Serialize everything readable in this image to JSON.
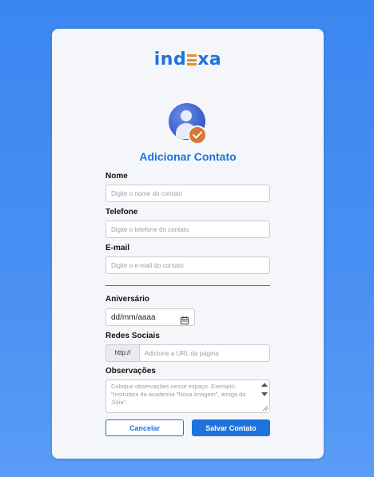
{
  "logo": {
    "text_left": "ind",
    "text_right": "xa"
  },
  "form": {
    "title": "Adicionar Contato",
    "nome": {
      "label": "Nome",
      "placeholder": "Digite o nome do contato"
    },
    "telefone": {
      "label": "Telefone",
      "placeholder": "Digite o telefone do contato"
    },
    "email": {
      "label": "E-mail",
      "placeholder": "Digite o e-mail do contato"
    },
    "aniversario": {
      "label": "Aniversário",
      "value": "dd/mm/aaaa"
    },
    "redes": {
      "label": "Redes Sociais",
      "prefix": "http://",
      "placeholder": "Adicione a URL da página"
    },
    "observacoes": {
      "label": "Observações",
      "placeholder": "Coloque observações nesse espaço. Exemplo: \"Instrutora da academia \"Nova Imagem\", amiga da Júlia\"."
    },
    "cancel_label": "Cancelar",
    "save_label": "Salvar Contato"
  },
  "colors": {
    "accent": "#1e73dc",
    "logo_e": "#f08a24",
    "badge": "#d9773a"
  },
  "icons": [
    "user-avatar-icon",
    "check-badge-icon",
    "calendar-icon"
  ]
}
